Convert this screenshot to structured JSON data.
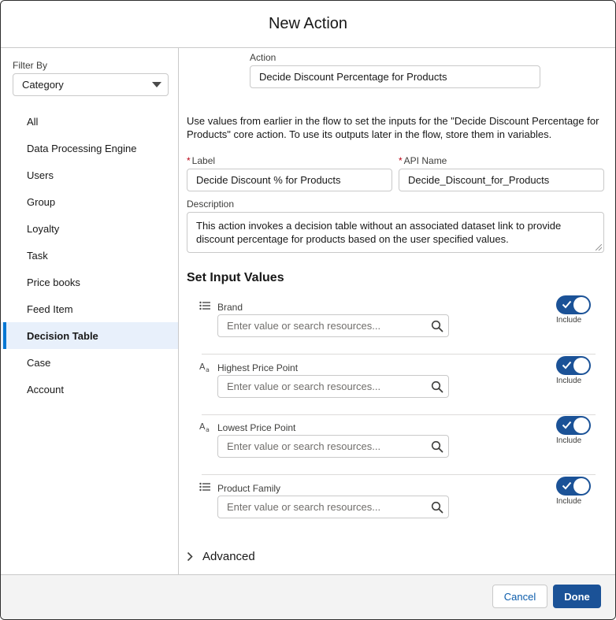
{
  "modal": {
    "title": "New Action"
  },
  "sidebar": {
    "filter_label": "Filter By",
    "filter_value": "Category",
    "items": [
      {
        "label": "All"
      },
      {
        "label": "Data Processing Engine"
      },
      {
        "label": "Users"
      },
      {
        "label": "Group"
      },
      {
        "label": "Loyalty"
      },
      {
        "label": "Task"
      },
      {
        "label": "Price books"
      },
      {
        "label": "Feed Item"
      },
      {
        "label": "Decision Table",
        "active": true
      },
      {
        "label": "Case"
      },
      {
        "label": "Account"
      }
    ]
  },
  "main": {
    "action_label": "Action",
    "action_value": "Decide Discount Percentage for Products",
    "intro": "Use values from earlier in the flow to set the inputs for the \"Decide Discount Percentage for Products\" core action. To use its outputs later in the flow, store them in variables.",
    "label_field": {
      "label": "Label",
      "value": "Decide Discount % for Products"
    },
    "api_field": {
      "label": "API Name",
      "value": "Decide_Discount_for_Products"
    },
    "required_marker": "*",
    "description": {
      "label": "Description",
      "value": "This action invokes a decision table without an associated dataset link to provide discount percentage for products based on the user specified values."
    },
    "section_title": "Set Input Values",
    "search_placeholder": "Enter value or search resources...",
    "include_label": "Include",
    "inputs": [
      {
        "label": "Brand",
        "icon": "list-icon",
        "included": true
      },
      {
        "label": "Highest Price Point",
        "icon": "text-icon",
        "included": true
      },
      {
        "label": "Lowest Price Point",
        "icon": "text-icon",
        "included": true
      },
      {
        "label": "Product Family",
        "icon": "list-icon",
        "included": true
      }
    ],
    "advanced_label": "Advanced"
  },
  "footer": {
    "cancel_label": "Cancel",
    "done_label": "Done"
  },
  "colors": {
    "brand": "#1b5297",
    "active_bg": "#e8f0fb",
    "required": "#ba0517"
  }
}
